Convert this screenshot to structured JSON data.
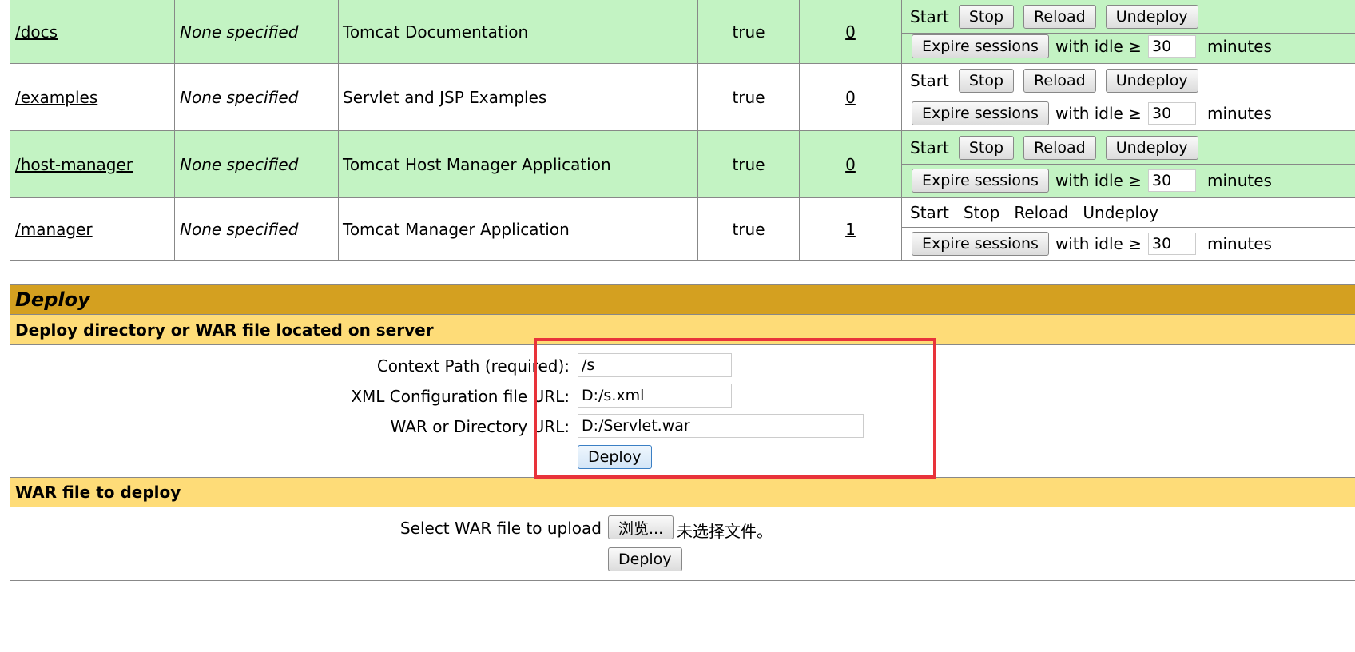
{
  "apps": [
    {
      "path": "/docs",
      "version": "None specified",
      "name": "Tomcat Documentation",
      "running": "true",
      "sessions": "0",
      "style": "green",
      "buttons_enabled": true
    },
    {
      "path": "/examples",
      "version": "None specified",
      "name": "Servlet and JSP Examples",
      "running": "true",
      "sessions": "0",
      "style": "white",
      "buttons_enabled": true
    },
    {
      "path": "/host-manager",
      "version": "None specified",
      "name": "Tomcat Host Manager Application",
      "running": "true",
      "sessions": "0",
      "style": "green",
      "buttons_enabled": true
    },
    {
      "path": "/manager",
      "version": "None specified",
      "name": "Tomcat Manager Application",
      "running": "true",
      "sessions": "1",
      "style": "white",
      "buttons_enabled": false
    }
  ],
  "commands": {
    "start": "Start",
    "stop": "Stop",
    "reload": "Reload",
    "undeploy": "Undeploy",
    "expire": "Expire sessions",
    "with_idle": "with idle ≥",
    "idle_value": "30",
    "minutes": "minutes"
  },
  "deploy": {
    "title": "Deploy",
    "server_section": "Deploy directory or WAR file located on server",
    "context_label": "Context Path (required):",
    "context_value": "/s",
    "xml_label": "XML Configuration file URL:",
    "xml_value": "D:/s.xml",
    "war_label": "WAR or Directory URL:",
    "war_value": "D:/Servlet.war",
    "deploy_button": "Deploy",
    "upload_section": "WAR file to deploy",
    "upload_label": "Select WAR file to upload",
    "browse_button": "浏览...",
    "no_file": "未选择文件。",
    "upload_deploy_button": "Deploy"
  },
  "colors": {
    "highlight": "#e8333a",
    "row_green": "#c3f3c3",
    "deploy_header": "#d4a020",
    "section_header": "#fedc78"
  }
}
